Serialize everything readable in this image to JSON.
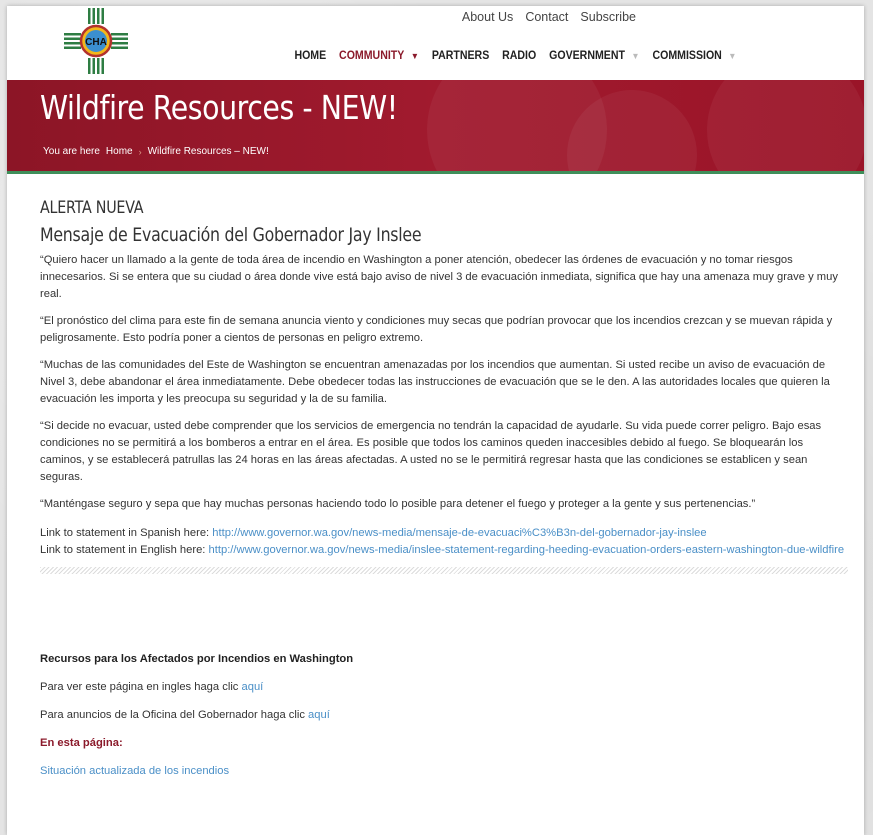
{
  "header": {
    "logo_text": "CHA",
    "top_links": [
      "About Us",
      "Contact",
      "Subscribe"
    ],
    "nav": {
      "home": "HOME",
      "community": "COMMUNITY",
      "partners": "PARTNERS",
      "radio": "RADIO",
      "government": "GOVERNMENT",
      "commission": "COMMISSION"
    }
  },
  "banner": {
    "title": "Wildfire Resources - NEW!",
    "breadcrumb_prefix": "You are here",
    "breadcrumb_home": "Home",
    "breadcrumb_current": "Wildfire Resources – NEW!"
  },
  "content": {
    "alert_heading": "ALERTA NUEVA",
    "message_heading": "Mensaje de Evacuación del Gobernador Jay Inslee",
    "paragraphs": [
      "“Quiero hacer un llamado a la gente de toda área de incendio en Washington a poner atención, obedecer las órdenes de evacuación y no tomar riesgos innecesarios. Si se entera que su ciudad o área donde vive está bajo aviso de nivel 3 de evacuación inmediata, significa que hay una amenaza muy grave y muy real.",
      "“El pronóstico del clima para este fin de semana anuncia viento y condiciones muy secas que podrían provocar que los incendios crezcan y se muevan rápida y peligrosamente. Esto podría poner a cientos de personas en peligro extremo.",
      "“Muchas de las comunidades del Este de Washington se encuentran amenazadas por los incendios que aumentan. Si usted recibe un aviso de evacuación de Nivel 3, debe abandonar el área inmediatamente. Debe obedecer todas las instrucciones de evacuación que se le den. A las autoridades locales que quieren la evacuación les importa y les preocupa su seguridad y la de su familia.",
      "“Si decide no evacuar, usted debe comprender que los servicios de emergencia no tendrán la capacidad de ayudarle. Su vida puede correr peligro. Bajo esas condiciones no se permitirá a los bomberos a entrar en el área. Es posible que todos los caminos queden inaccesibles debido al fuego. Se bloquearán los caminos, y se establecerá patrullas las 24 horas en las áreas afectadas. A usted no se le permitirá regresar hasta que las condiciones se establicen y sean seguras.",
      "“Manténgase seguro y sepa que hay muchas personas haciendo todo lo posible para detener el fuego y proteger a la gente y sus pertenencias.”"
    ],
    "link_spanish_label": "Link to statement in Spanish here: ",
    "link_spanish_url": "http://www.governor.wa.gov/news-media/mensaje-de-evacuaci%C3%B3n-del-gobernador-jay-inslee",
    "link_english_label": "Link to statement in English here: ",
    "link_english_url": "http://www.governor.wa.gov/news-media/inslee-statement-regarding-heeding-evacuation-orders-eastern-washington-due-wildfire",
    "resources_title": "Recursos para los Afectados por Incendios en Washington",
    "english_page_text": "Para ver este página en ingles haga clic ",
    "english_page_link": "aquí",
    "governor_text": "Para anuncios de la Oficina del Gobernador haga clic ",
    "governor_link": "aquí",
    "on_this_page": "En esta página:",
    "situation_link": "Situación actualizada de los incendios"
  },
  "colors": {
    "banner": "#9a1428",
    "accent_green": "#3f8f5a",
    "link": "#4a8fc7",
    "active_nav": "#8b1a2b"
  }
}
